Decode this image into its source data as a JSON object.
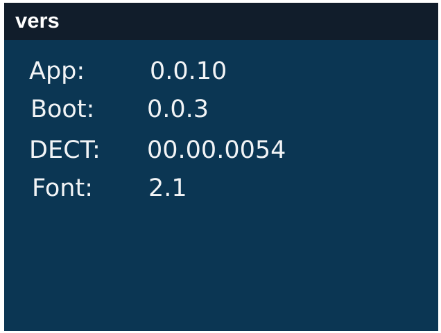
{
  "header": {
    "title": "vers"
  },
  "version_info": [
    {
      "label": "App:",
      "value": "0.0.10"
    },
    {
      "label": "Boot:",
      "value": "0.0.3"
    },
    {
      "label": "DECT:",
      "value": "00.00.0054"
    },
    {
      "label": "Font:",
      "value": "2.1"
    }
  ],
  "colors": {
    "screen_background": "#0b3653",
    "title_bar_background": "#111d2b",
    "text": "#ffffff"
  }
}
